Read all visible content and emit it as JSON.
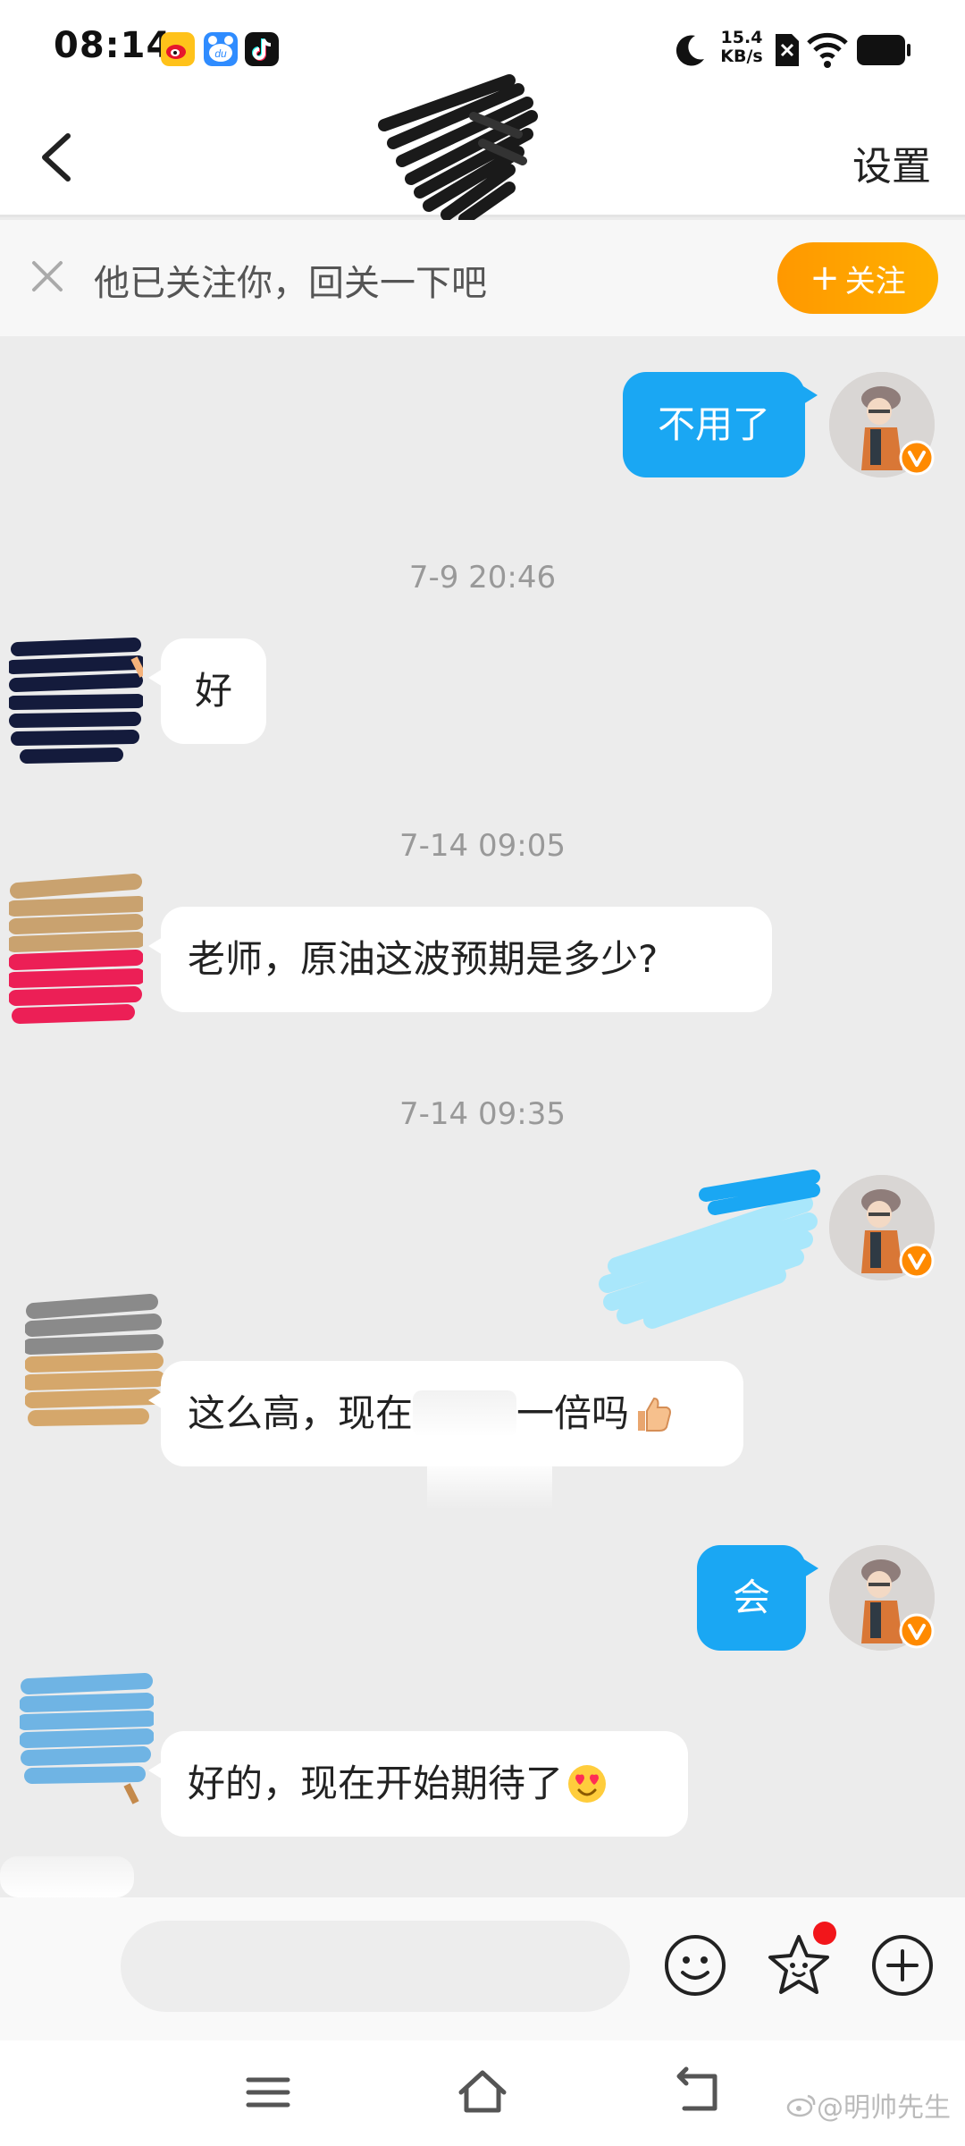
{
  "status_bar": {
    "time": "08:14",
    "net_speed_value": "15.4",
    "net_speed_unit": "KB/s",
    "icons": [
      "weibo-icon",
      "baidu-netdisk-icon",
      "tiktok-icon",
      "moon-icon",
      "no-sim-icon",
      "wifi-icon",
      "battery-icon"
    ]
  },
  "nav": {
    "back_icon": "chevron-left-icon",
    "settings_label": "设置"
  },
  "follow_banner": {
    "text": "他已关注你，回关一下吧",
    "follow_button_label": "关注",
    "colors": {
      "button": "#ff9f00"
    }
  },
  "messages": [
    {
      "side": "out",
      "text": "不用了"
    },
    {
      "timestamp": "7-9 20:46"
    },
    {
      "side": "in",
      "text": "好"
    },
    {
      "timestamp": "7-14 09:05"
    },
    {
      "side": "in",
      "text": "老师，原油这波预期是多少?"
    },
    {
      "timestamp": "7-14 09:35"
    },
    {
      "side": "out",
      "text": ""
    },
    {
      "side": "in",
      "text_before": "这么高，现在",
      "text_after": "一倍吗",
      "emoji": "thumbs-up-icon"
    },
    {
      "side": "out",
      "text": "会"
    },
    {
      "side": "in",
      "text": "好的，现在开始期待了",
      "emoji": "heart-eyes-icon"
    }
  ],
  "colors": {
    "outgoing_bubble": "#1aa7f3",
    "incoming_bubble": "#ffffff",
    "chat_background": "#ececec",
    "verified_badge": "#ff8a00"
  },
  "input_bar": {
    "placeholder": "",
    "icons": [
      "smiley-icon",
      "star-face-icon",
      "plus-circle-icon"
    ]
  },
  "system_nav": {
    "icons": [
      "menu-icon",
      "home-icon",
      "back-icon"
    ]
  },
  "watermark": "@明帅先生"
}
